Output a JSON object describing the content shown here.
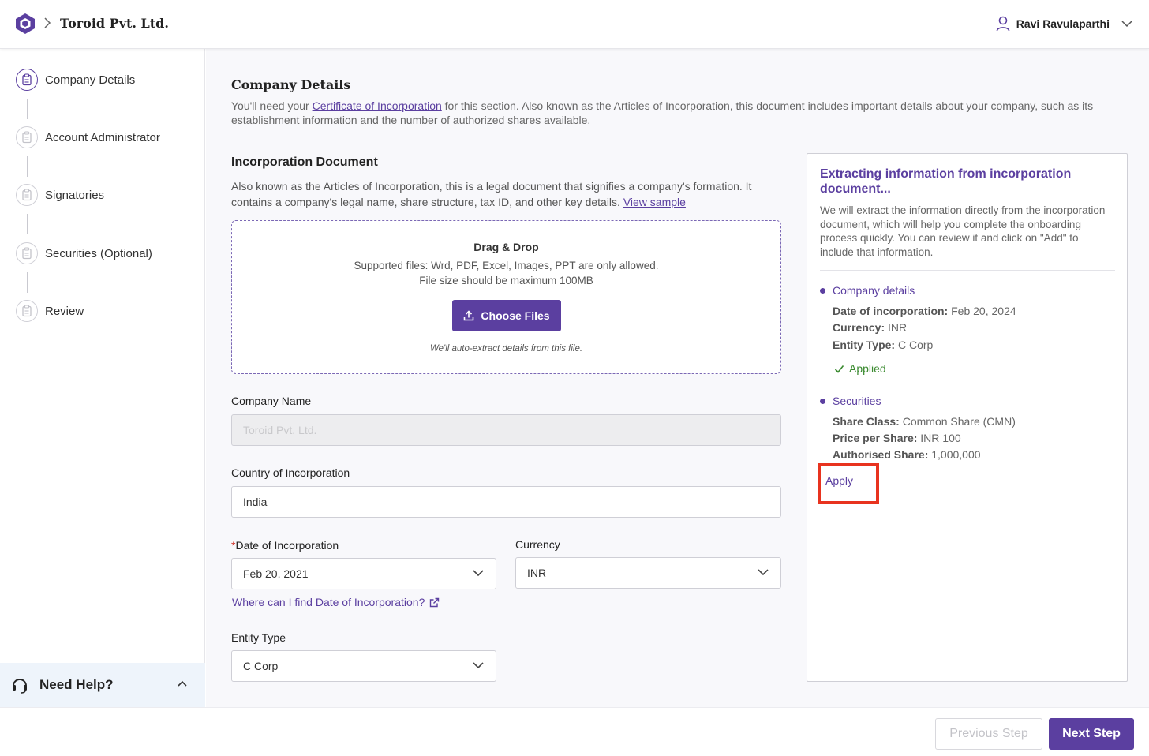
{
  "header": {
    "company": "Toroid Pvt. Ltd.",
    "user": "Ravi Ravulaparthi"
  },
  "sidebar": {
    "steps": [
      {
        "label": "Company Details",
        "active": true
      },
      {
        "label": "Account Administrator",
        "active": false
      },
      {
        "label": "Signatories",
        "active": false
      },
      {
        "label": "Securities (Optional)",
        "active": false
      },
      {
        "label": "Review",
        "active": false
      }
    ],
    "help_label": "Need Help?"
  },
  "main": {
    "title": "Company Details",
    "intro_pre": "You'll need your ",
    "intro_link": "Certificate of Incorporation",
    "intro_post": " for this section. Also known as the Articles of Incorporation, this document includes important details about your company, such as its establishment information and the number of authorized shares available.",
    "doc_title": "Incorporation Document",
    "doc_desc": "Also known as the Articles of Incorporation, this is a legal document that signifies a company's formation. It contains a company's legal name, share structure, tax ID, and other key details. ",
    "doc_link": "View sample",
    "dropzone": {
      "title": "Drag & Drop",
      "line1": "Supported files: Wrd, PDF, Excel, Images, PPT are only allowed.",
      "line2": "File size should be maximum 100MB",
      "button": "Choose Files",
      "note": "We'll auto-extract details from this file."
    },
    "fields": {
      "company_name_label": "Company Name",
      "company_name_value": "Toroid Pvt. Ltd.",
      "country_label": "Country of Incorporation",
      "country_value": "India",
      "date_req": "*",
      "date_label": "Date of Incorporation",
      "date_value": "Feb 20, 2021",
      "currency_label": "Currency",
      "currency_value": "INR",
      "date_help": "Where can I find Date of Incorporation?",
      "entity_label": "Entity Type",
      "entity_value": "C Corp"
    }
  },
  "panel": {
    "title": "Extracting information from incorporation document...",
    "desc": "We will extract the information directly from the incorporation document, which will help you complete the onboarding process quickly. You can review it and click on \"Add\" to include that information.",
    "company_section": "Company details",
    "company_items": [
      {
        "k": "Date of incorporation:",
        "v": "Feb 20, 2024"
      },
      {
        "k": "Currency:",
        "v": "INR"
      },
      {
        "k": "Entity Type:",
        "v": "C Corp"
      }
    ],
    "applied": "Applied",
    "securities_section": "Securities",
    "securities_items": [
      {
        "k": "Share Class:",
        "v": "Common Share (CMN)"
      },
      {
        "k": "Price per Share:",
        "v": "INR 100"
      },
      {
        "k": "Authorised Share:",
        "v": "1,000,000"
      }
    ],
    "apply": "Apply"
  },
  "footer": {
    "prev": "Previous Step",
    "next": "Next Step"
  },
  "colors": {
    "accent": "#5b3fa0",
    "highlight": "#e8331f",
    "success": "#3a8a2f"
  }
}
